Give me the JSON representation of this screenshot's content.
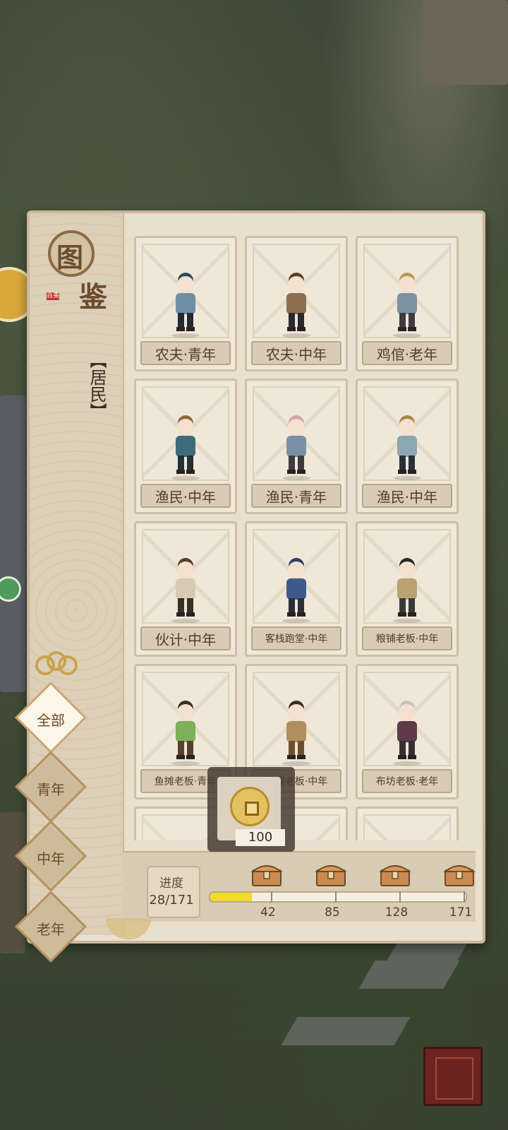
{
  "title_glyphs": [
    "图",
    "鉴"
  ],
  "seal_text": "百夷",
  "category": "【居民】",
  "cards": [
    {
      "label": "农夫·青年",
      "small": false
    },
    {
      "label": "农夫·中年",
      "small": false
    },
    {
      "label": "鸡倌·老年",
      "small": false
    },
    {
      "label": "渔民·中年",
      "small": false
    },
    {
      "label": "渔民·青年",
      "small": false
    },
    {
      "label": "渔民·中年",
      "small": false
    },
    {
      "label": "伙计·中年",
      "small": false
    },
    {
      "label": "客栈跑堂·中年",
      "small": true
    },
    {
      "label": "粮铺老板·中年",
      "small": true
    },
    {
      "label": "鱼摊老板·青年",
      "small": true
    },
    {
      "label": "茶楼老板·中年",
      "small": true
    },
    {
      "label": "布坊老板·老年",
      "small": true
    }
  ],
  "tabs": [
    "全部",
    "青年",
    "中年",
    "老年"
  ],
  "progress": {
    "label": "进度",
    "count_text": "28/171",
    "current": 28,
    "total": 171,
    "milestones": [
      "42",
      "85",
      "128",
      "171"
    ]
  },
  "reward_tooltip": {
    "value": "100",
    "icon": "coin-icon"
  },
  "corner_button": {
    "icon": "jieyou-icon"
  },
  "colors": {
    "accent": "#f1da2a",
    "paper": "#e9dfcd"
  }
}
